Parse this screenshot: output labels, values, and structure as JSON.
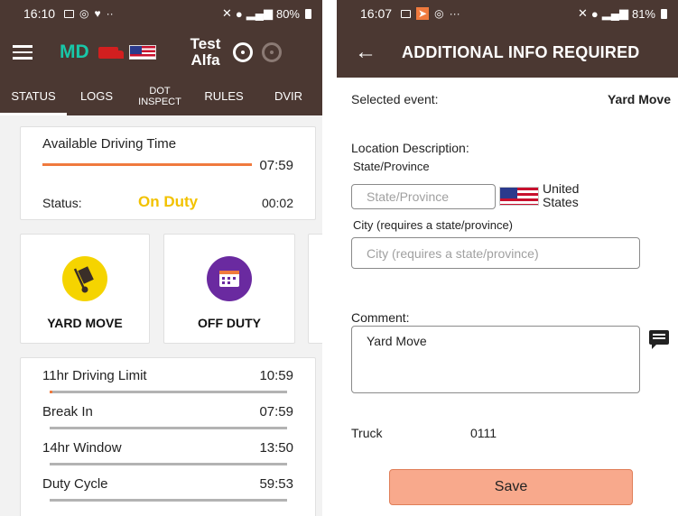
{
  "left": {
    "statusbar": {
      "time": "16:10",
      "battery": "80%"
    },
    "appbar": {
      "carrier_code": "MD",
      "driver_name_line1": "Test",
      "driver_name_line2": "Alfa"
    },
    "tabs": [
      {
        "label": "STATUS",
        "active": true
      },
      {
        "label": "LOGS"
      },
      {
        "label": "DOT INSPECT"
      },
      {
        "label": "RULES"
      },
      {
        "label": "DVIR"
      }
    ],
    "driving_time": {
      "title": "Available Driving Time",
      "value": "07:59",
      "status_label": "Status:",
      "status_value": "On Duty",
      "status_time": "00:02"
    },
    "tiles": [
      {
        "label": "YARD MOVE",
        "icon": "hand-truck-icon",
        "color": "#f5d400"
      },
      {
        "label": "OFF DUTY",
        "icon": "calendar-icon",
        "color": "#6a2aa0"
      }
    ],
    "limits": [
      {
        "label": "11hr Driving Limit",
        "value": "10:59",
        "fill": 0.01
      },
      {
        "label": "Break In",
        "value": "07:59",
        "fill": 0.0
      },
      {
        "label": "14hr Window",
        "value": "13:50",
        "fill": 0.0
      },
      {
        "label": "Duty Cycle",
        "value": "59:53",
        "fill": 0.0
      }
    ]
  },
  "right": {
    "statusbar": {
      "time": "16:07",
      "battery": "81%"
    },
    "title": "ADDITIONAL INFO REQUIRED",
    "selected_event_label": "Selected event:",
    "selected_event_value": "Yard Move",
    "location_description_label": "Location Description:",
    "state_label": "State/Province",
    "state_placeholder": "State/Province",
    "country_line1": "United",
    "country_line2": "States",
    "city_label": "City (requires a state/province)",
    "city_placeholder": "City (requires a state/province)",
    "comment_label": "Comment:",
    "comment_value": "Yard Move",
    "truck_label": "Truck",
    "truck_value": "0111",
    "save_label": "Save"
  },
  "colors": {
    "appbar": "#4b3832",
    "accent_orange": "#f07a3e",
    "on_duty_yellow": "#f2c200",
    "save_button": "#f8a98c",
    "teal": "#18c7a8"
  }
}
